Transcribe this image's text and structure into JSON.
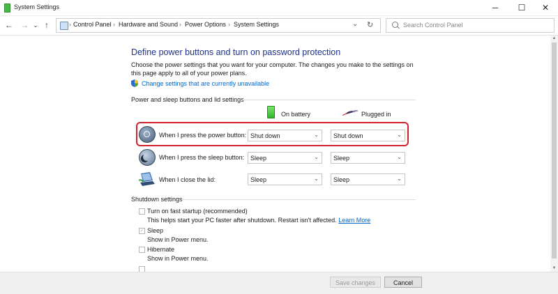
{
  "window": {
    "title": "System Settings",
    "controls": {
      "minimize": "─",
      "maximize": "☐",
      "close": "✕"
    }
  },
  "nav": {
    "back": "←",
    "forward": "→",
    "recent": "⌄",
    "up": "↑",
    "breadcrumb": [
      "Control Panel",
      "Hardware and Sound",
      "Power Options",
      "System Settings"
    ],
    "breadcrumb_sep": "›",
    "dropdown": "⌄",
    "refresh": "↻",
    "search_placeholder": "Search Control Panel"
  },
  "main": {
    "title": "Define power buttons and turn on password protection",
    "description": "Choose the power settings that you want for your computer. The changes you make to the settings on this page apply to all of your power plans.",
    "change_link": "Change settings that are currently unavailable",
    "power_section_title": "Power and sleep buttons and lid settings",
    "columns": {
      "on_battery": "On battery",
      "plugged_in": "Plugged in"
    },
    "rows": [
      {
        "label": "When I press the power button:",
        "on_battery": "Shut down",
        "plugged_in": "Shut down",
        "icon": "power-icon"
      },
      {
        "label": "When I press the sleep button:",
        "on_battery": "Sleep",
        "plugged_in": "Sleep",
        "icon": "sleep-icon"
      },
      {
        "label": "When I close the lid:",
        "on_battery": "Sleep",
        "plugged_in": "Sleep",
        "icon": "laptop-lid-icon"
      }
    ],
    "shutdown_section_title": "Shutdown settings",
    "shutdown_options": [
      {
        "label": "Turn on fast startup (recommended)",
        "desc": "This helps start your PC faster after shutdown. Restart isn't affected.",
        "link": "Learn More",
        "checked": false
      },
      {
        "label": "Sleep",
        "desc": "Show in Power menu.",
        "checked": true
      },
      {
        "label": "Hibernate",
        "desc": "Show in Power menu.",
        "checked": false
      }
    ],
    "chevron": "⌄",
    "checkmark": "✓"
  },
  "footer": {
    "save": "Save changes",
    "cancel": "Cancel"
  },
  "colors": {
    "title_blue": "#1e3287",
    "link_blue": "#0066cc",
    "highlight_red": "#d0222f"
  }
}
